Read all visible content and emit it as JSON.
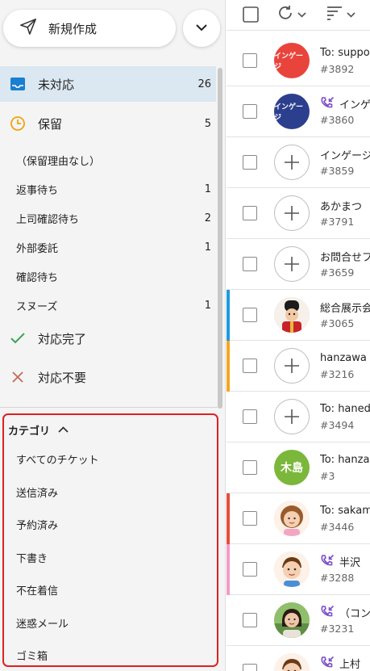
{
  "sidebar": {
    "new_button_label": "新規作成",
    "main_items": [
      {
        "label": "未対応",
        "count": "26",
        "icon": "inbox-icon"
      },
      {
        "label": "保留",
        "count": "5",
        "icon": "clock-icon"
      }
    ],
    "hold_reasons": [
      {
        "label": "（保留理由なし）",
        "count": ""
      },
      {
        "label": "返事待ち",
        "count": "1"
      },
      {
        "label": "上司確認待ち",
        "count": "2"
      },
      {
        "label": "外部委託",
        "count": "1"
      },
      {
        "label": "確認待ち",
        "count": ""
      },
      {
        "label": "スヌーズ",
        "count": "1"
      }
    ],
    "status_items": [
      {
        "label": "対応完了",
        "icon": "check-icon"
      },
      {
        "label": "対応不要",
        "icon": "x-icon"
      }
    ],
    "category_header": "カテゴリ",
    "categories": [
      "すべてのチケット",
      "送信済み",
      "予約済み",
      "下書き",
      "不在着信",
      "迷惑メール",
      "ゴミ箱"
    ]
  },
  "colors": {
    "selected_bg": "#dbe7f1",
    "inbox_icon": "#1a7fd0",
    "clock_icon": "#f2a20c",
    "check_icon": "#3aa55a",
    "x_icon": "#c46b55",
    "category_border": "#e02020",
    "phone_icon": "#7b4fc9"
  },
  "tickets": [
    {
      "title": "To: suppo",
      "number": "#3892",
      "avatar_text": "インゲージ",
      "avatar_type": "red",
      "phone": false,
      "bar": ""
    },
    {
      "title": "インゲ",
      "number": "#3860",
      "avatar_text": "インゲージ",
      "avatar_type": "navy",
      "phone": true,
      "bar": ""
    },
    {
      "title": "インゲージ",
      "number": "#3859",
      "avatar_text": "",
      "avatar_type": "plus",
      "phone": false,
      "bar": ""
    },
    {
      "title": "あかまつ",
      "number": "#3791",
      "avatar_text": "",
      "avatar_type": "plus",
      "phone": false,
      "bar": ""
    },
    {
      "title": "お問合せフ",
      "number": "#3659",
      "avatar_text": "",
      "avatar_type": "plus",
      "phone": false,
      "bar": ""
    },
    {
      "title": "総合展示会",
      "number": "#3065",
      "avatar_text": "",
      "avatar_type": "guard",
      "phone": false,
      "bar": "#1e9be0"
    },
    {
      "title": "hanzawa",
      "number": "#3216",
      "avatar_text": "",
      "avatar_type": "plus",
      "phone": false,
      "bar": "#f5a623"
    },
    {
      "title": "To: haned",
      "number": "#3494",
      "avatar_text": "",
      "avatar_type": "plus",
      "phone": false,
      "bar": ""
    },
    {
      "title": "To: hanza",
      "number": "#3",
      "avatar_text": "木島",
      "avatar_type": "green",
      "phone": false,
      "bar": ""
    },
    {
      "title": "To: sakam",
      "number": "#3446",
      "avatar_text": "",
      "avatar_type": "woman",
      "phone": false,
      "bar": "#e74c3c"
    },
    {
      "title": "半沢",
      "number": "#3288",
      "avatar_text": "",
      "avatar_type": "man",
      "phone": true,
      "bar": "#f59ac6"
    },
    {
      "title": "（コン",
      "number": "#3231",
      "avatar_text": "",
      "avatar_type": "photo",
      "phone": true,
      "bar": ""
    },
    {
      "title": "上村",
      "number": "",
      "avatar_text": "",
      "avatar_type": "man",
      "phone": true,
      "bar": ""
    }
  ]
}
